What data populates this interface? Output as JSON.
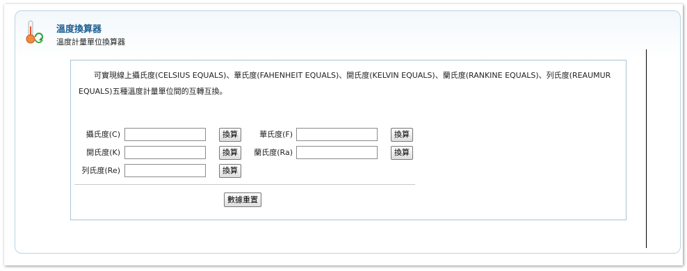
{
  "header": {
    "title": "溫度換算器",
    "subtitle": "溫度計量單位換算器",
    "icon": "thermometer-icon"
  },
  "description": "　　可實現線上攝氏度(CELSIUS EQUALS)、華氏度(FAHENHEIT EQUALS)、開氏度(KELVIN EQUALS)、蘭氏度(RANKINE EQUALS)、列氏度(REAUMUR EQUALS)五種溫度計量單位間的互轉互換。",
  "form": {
    "celsius_label": "攝氏度(C)",
    "fahrenheit_label": "華氏度(F)",
    "kelvin_label": "開氏度(K)",
    "rankine_label": "蘭氏度(Ra)",
    "reaumur_label": "列氏度(Re)",
    "celsius_value": "",
    "fahrenheit_value": "",
    "kelvin_value": "",
    "rankine_value": "",
    "reaumur_value": "",
    "convert_label": "換算",
    "reset_label": "數據重置"
  },
  "colors": {
    "title": "#1d5f92",
    "panel_border": "#b9d4e6",
    "box_border": "#a9c3d6"
  }
}
